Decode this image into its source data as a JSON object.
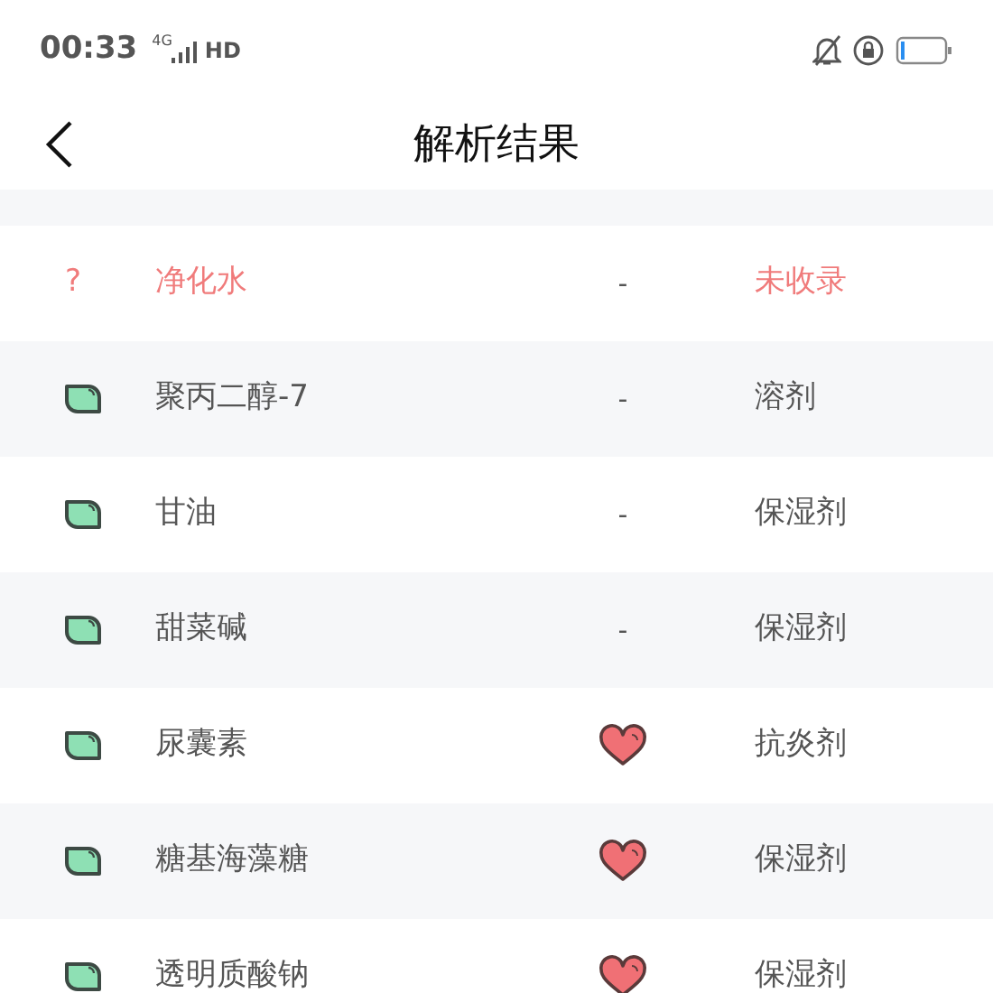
{
  "status_bar": {
    "time": "00:33",
    "network": "4G",
    "hd": "HD"
  },
  "header": {
    "title": "解析结果"
  },
  "rows": [
    {
      "kind": "unknown",
      "icon": "?",
      "name": "净化水",
      "middle": {
        "kind": "text",
        "text": "-"
      },
      "category": "未收录"
    },
    {
      "kind": "leaf",
      "name": "聚丙二醇-7",
      "middle": {
        "kind": "text",
        "text": "-"
      },
      "category": "溶剂"
    },
    {
      "kind": "leaf",
      "name": "甘油",
      "middle": {
        "kind": "text",
        "text": "-"
      },
      "category": "保湿剂"
    },
    {
      "kind": "leaf",
      "name": "甜菜碱",
      "middle": {
        "kind": "text",
        "text": "-"
      },
      "category": "保湿剂"
    },
    {
      "kind": "leaf",
      "name": "尿囊素",
      "middle": {
        "kind": "heart"
      },
      "category": "抗炎剂"
    },
    {
      "kind": "leaf",
      "name": "糖基海藻糖",
      "middle": {
        "kind": "heart"
      },
      "category": "保湿剂"
    },
    {
      "kind": "leaf",
      "name": "透明质酸钠",
      "middle": {
        "kind": "heart"
      },
      "category": "保湿剂"
    }
  ]
}
